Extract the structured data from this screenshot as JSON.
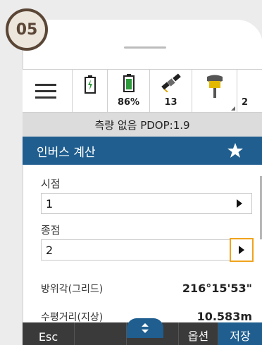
{
  "step_badge": "05",
  "status_bar": {
    "battery1_label": "",
    "battery2_label": "86%",
    "satellite_count": "13",
    "receiver_label": "",
    "overflow_label": "2"
  },
  "info_bar": {
    "text": "측량 없음 PDOP:1.9"
  },
  "title_bar": {
    "title": "인버스 계산"
  },
  "form": {
    "start_label": "시점",
    "start_value": "1",
    "end_label": "종점",
    "end_value": "2"
  },
  "results": [
    {
      "label": "방위각(그리드)",
      "value": "216°15'53\""
    },
    {
      "label": "수평거리(지상)",
      "value": "10.583m"
    }
  ],
  "bottom_bar": {
    "esc_label": "Esc",
    "options_label": "옵션",
    "store_label": "저장"
  },
  "colors": {
    "accent": "#1f5e8f",
    "focus": "#f0a31c",
    "bottom_bar": "#3a3a3a"
  }
}
